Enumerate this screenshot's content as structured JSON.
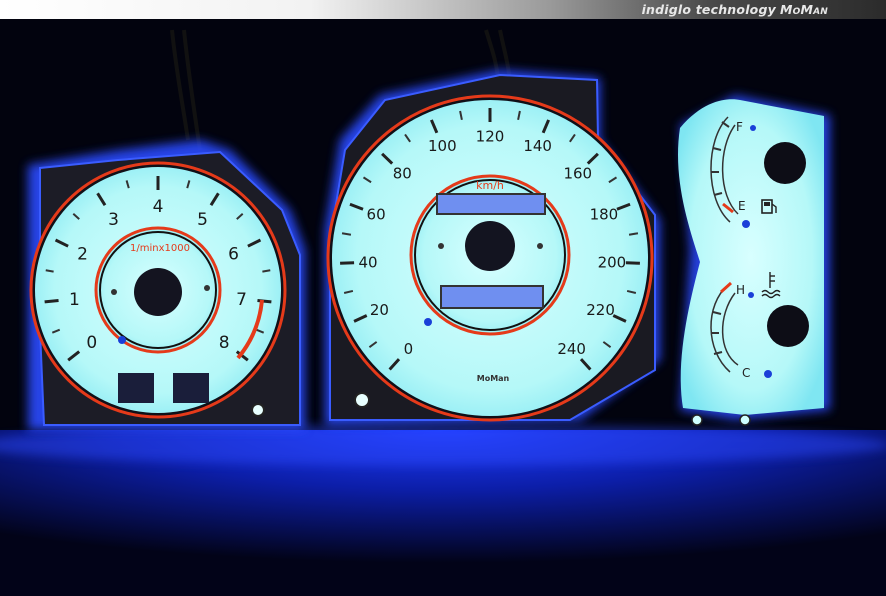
{
  "banner": {
    "text": "indiglo technology",
    "brand": "MoMan"
  },
  "tachometer": {
    "unit_label": "1/minx1000",
    "scale": [
      "0",
      "1",
      "2",
      "3",
      "4",
      "5",
      "6",
      "7",
      "8"
    ]
  },
  "speedometer": {
    "unit_label": "km/h",
    "scale": [
      "0",
      "20",
      "40",
      "60",
      "80",
      "100",
      "120",
      "140",
      "160",
      "180",
      "200",
      "220",
      "240"
    ],
    "brand": "MoMan"
  },
  "fuel_gauge": {
    "full_label": "F",
    "empty_label": "E"
  },
  "temp_gauge": {
    "hot_label": "H",
    "cold_label": "C"
  },
  "colors": {
    "glow": "#b8fbfb",
    "accent_red": "#e53a1a",
    "backlight_blue": "#2a4cff"
  }
}
